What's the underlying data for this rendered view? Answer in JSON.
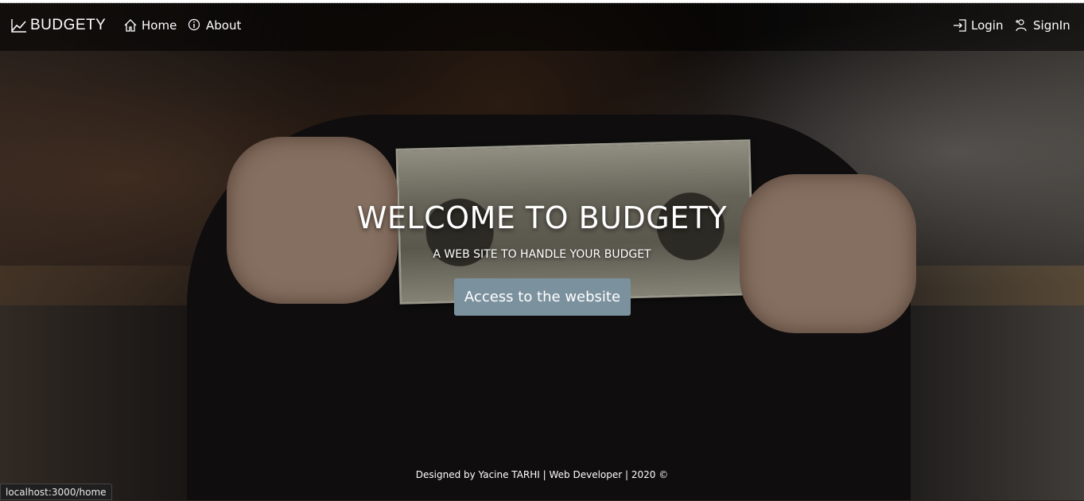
{
  "navbar": {
    "brand": "BUDGETY",
    "brand_icon": "trending-up-icon",
    "links": [
      {
        "label": "Home",
        "icon": "home-icon"
      },
      {
        "label": "About",
        "icon": "info-icon"
      }
    ],
    "right_links": [
      {
        "label": "Login",
        "icon": "login-icon"
      },
      {
        "label": "SignIn",
        "icon": "user-plus-icon"
      }
    ]
  },
  "hero": {
    "title": "WELCOME TO BUDGETY",
    "subtitle": "A WEB SITE TO HANDLE YOUR BUDGET",
    "cta_label": "Access to the website",
    "cta_color": "#7b919e"
  },
  "footer": {
    "text": "Designed by Yacine TARHI | Web Developer | 2020 ©"
  },
  "status_bar": {
    "url": "localhost:3000/home"
  }
}
